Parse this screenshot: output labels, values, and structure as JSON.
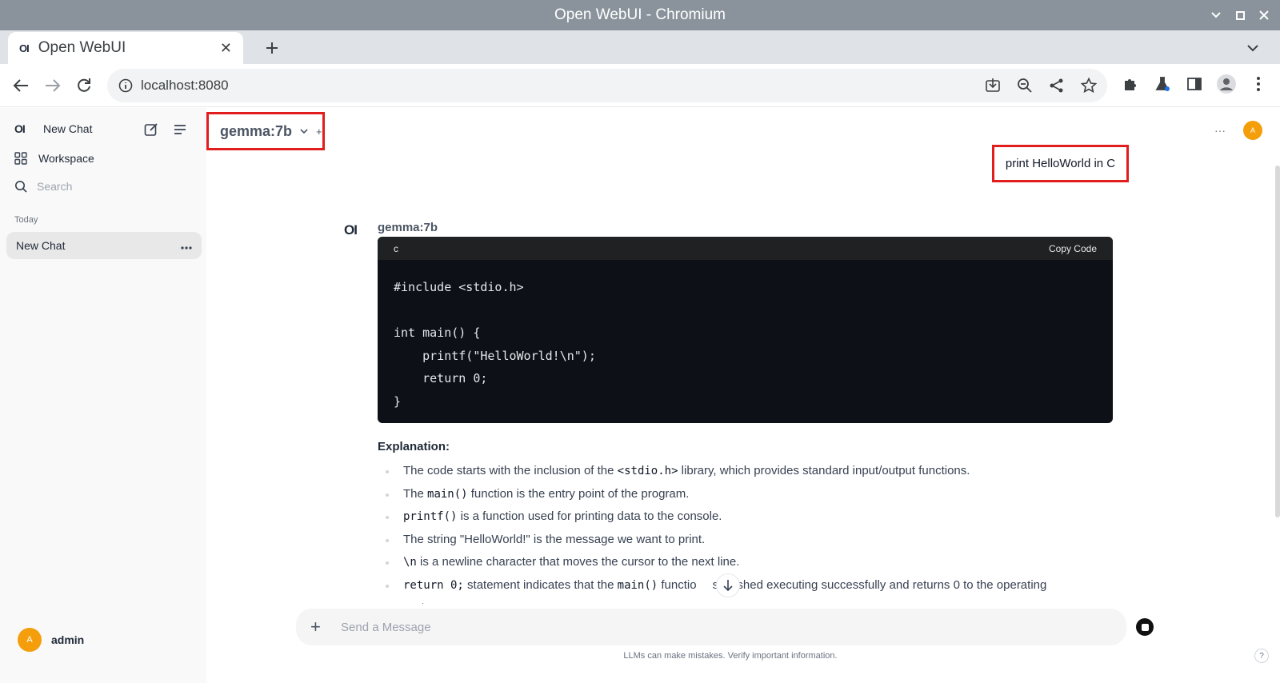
{
  "window": {
    "title": "Open WebUI - Chromium"
  },
  "browser": {
    "tab_title": "Open WebUI",
    "tab_favicon": "OI",
    "url": "localhost:8080"
  },
  "sidebar": {
    "logo": "OI",
    "new_chat": "New Chat",
    "workspace": "Workspace",
    "search_placeholder": "Search",
    "section_today": "Today",
    "chats": [
      {
        "title": "New Chat"
      }
    ],
    "user": {
      "initial": "A",
      "name": "admin"
    }
  },
  "header": {
    "model": "gemma:7b",
    "add_model": "+",
    "more": "···",
    "avatar_initial": "A"
  },
  "conversation": {
    "user_message": "print HelloWorld in C",
    "bot_logo": "OI",
    "bot_name": "gemma:7b",
    "code": {
      "language": "c",
      "copy_label": "Copy Code",
      "text": "#include <stdio.h>\n\nint main() {\n    printf(\"HelloWorld!\\n\");\n    return 0;\n}"
    },
    "explanation_title": "Explanation:",
    "bullets": {
      "b1_a": "The code starts with the inclusion of the ",
      "b1_code": "<stdio.h>",
      "b1_b": " library, which provides standard input/output functions.",
      "b2_a": "The ",
      "b2_code": "main()",
      "b2_b": " function is the entry point of the program.",
      "b3_code": "printf()",
      "b3_b": " is a function used for printing data to the console.",
      "b4": "The string \"HelloWorld!\" is the message we want to print.",
      "b5_code": "\\n",
      "b5_b": " is a newline character that moves the cursor to the next line.",
      "b6_code": "return 0;",
      "b6_b": " statement indicates that the ",
      "b6_code2": "main()",
      "b6_c": " functio",
      "b6_d": "s finished executing successfully and returns 0 to the operating",
      "b6_e": "system."
    }
  },
  "composer": {
    "placeholder": "Send a Message",
    "disclaimer": "LLMs can make mistakes. Verify important information.",
    "help": "?"
  },
  "colors": {
    "accent": "#f59e0b",
    "highlight": "#e11d1d",
    "code_bg": "#0d1117"
  }
}
